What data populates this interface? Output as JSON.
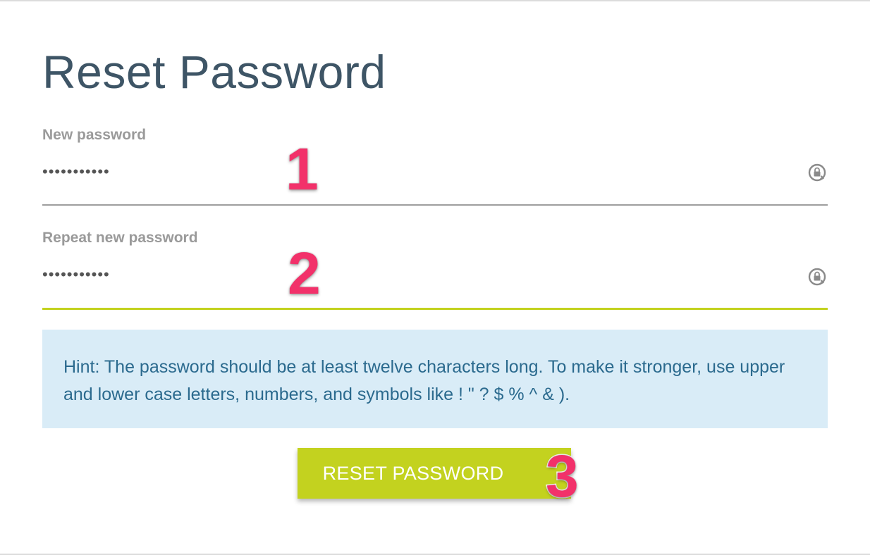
{
  "page": {
    "title": "Reset Password"
  },
  "form": {
    "new_password": {
      "label": "New password",
      "value": "•••••••••••",
      "icon": "lock-refresh-icon"
    },
    "repeat_password": {
      "label": "Repeat new password",
      "value": "•••••••••••",
      "icon": "lock-refresh-icon"
    },
    "hint": "Hint: The password should be at least twelve characters long. To make it stronger, use upper and lower case letters, numbers, and symbols like ! \" ? $ % ^ & ).",
    "submit_label": "RESET PASSWORD"
  },
  "annotations": {
    "step1": "1",
    "step2": "2",
    "step3": "3"
  },
  "colors": {
    "accent": "#c3d21f",
    "title": "#3e5566",
    "hint_bg": "#d9ecf7",
    "hint_text": "#2b6a8e",
    "badge": "#f2316a"
  }
}
